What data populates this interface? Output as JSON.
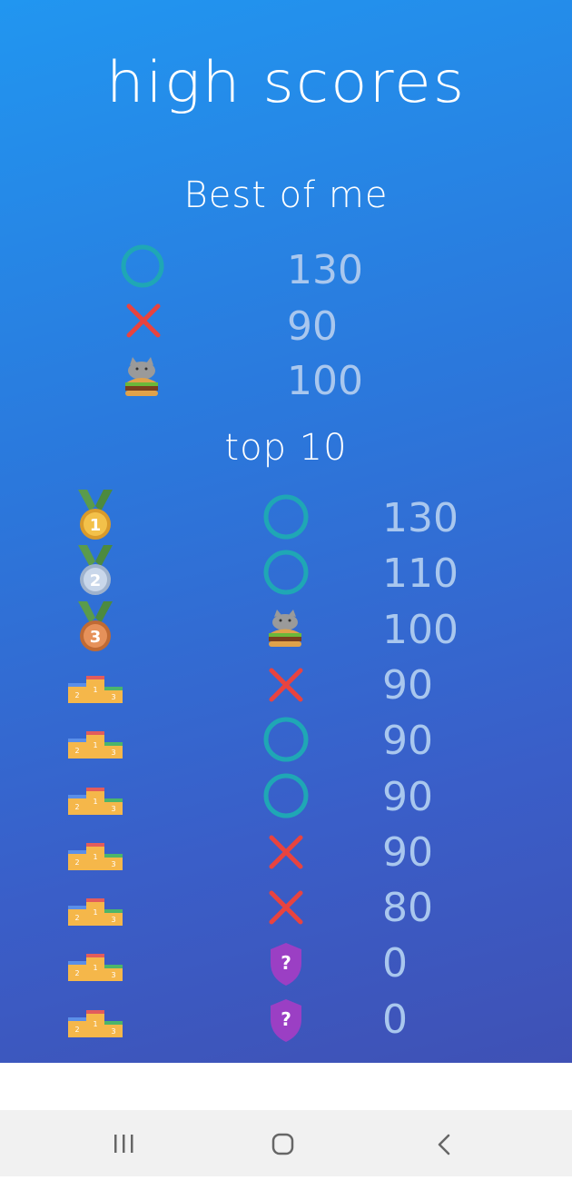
{
  "title": "high scores",
  "best": {
    "heading": "Best of me",
    "rows": [
      {
        "icon": "circle-icon",
        "score": "130"
      },
      {
        "icon": "x-icon",
        "score": "90"
      },
      {
        "icon": "cat-burger-icon",
        "score": "100"
      }
    ]
  },
  "top": {
    "heading": "top 10",
    "rows": [
      {
        "rank_icon": "gold-medal-icon",
        "rank": "1",
        "icon": "circle-icon",
        "score": "130"
      },
      {
        "rank_icon": "silver-medal-icon",
        "rank": "2",
        "icon": "circle-icon",
        "score": "110"
      },
      {
        "rank_icon": "bronze-medal-icon",
        "rank": "3",
        "icon": "cat-burger-icon",
        "score": "100"
      },
      {
        "rank_icon": "podium-icon",
        "icon": "x-icon",
        "score": "90"
      },
      {
        "rank_icon": "podium-icon",
        "icon": "circle-icon",
        "score": "90"
      },
      {
        "rank_icon": "podium-icon",
        "icon": "circle-icon",
        "score": "90"
      },
      {
        "rank_icon": "podium-icon",
        "icon": "x-icon",
        "score": "90"
      },
      {
        "rank_icon": "podium-icon",
        "icon": "x-icon",
        "score": "80"
      },
      {
        "rank_icon": "podium-icon",
        "icon": "unknown-shield-icon",
        "score": "0"
      },
      {
        "rank_icon": "podium-icon",
        "icon": "unknown-shield-icon",
        "score": "0"
      }
    ]
  },
  "colors": {
    "circle": "#1fa7b5",
    "x": "#e8433f",
    "score_text": "#a9c7ee",
    "shield": "#9b3fc4"
  },
  "nav": {
    "recents": "recents-icon",
    "home": "home-icon",
    "back": "back-icon"
  }
}
